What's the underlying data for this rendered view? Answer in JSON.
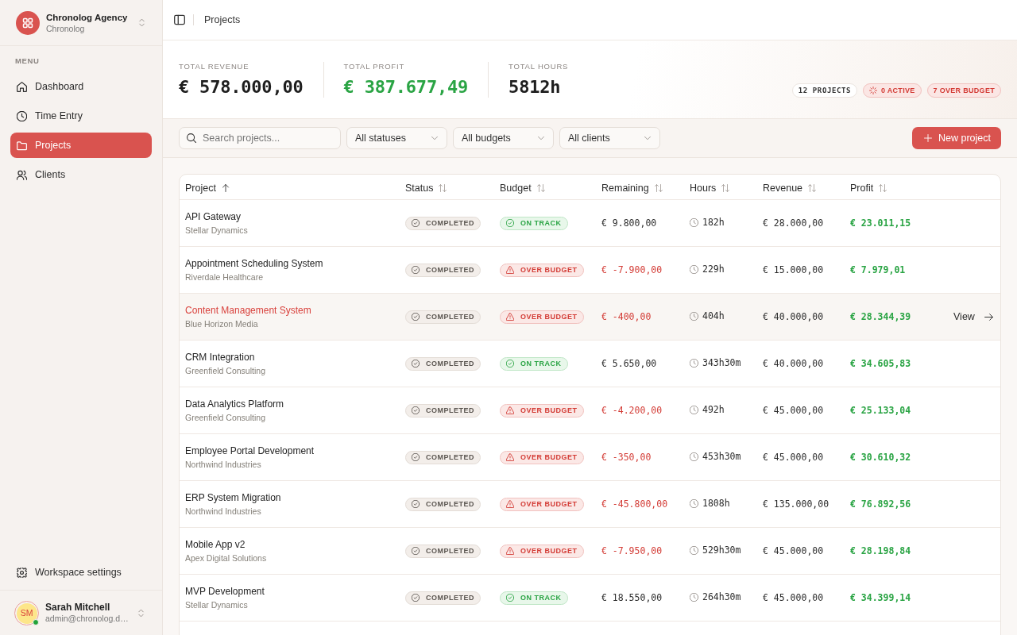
{
  "sidebar": {
    "workspace": {
      "name": "Chronolog Agency",
      "subtitle": "Chronolog"
    },
    "section_label": "MENU",
    "items": [
      {
        "label": "Dashboard",
        "kind": "home",
        "selected": false
      },
      {
        "label": "Time Entry",
        "kind": "clock",
        "selected": false
      },
      {
        "label": "Projects",
        "kind": "folder",
        "selected": true
      },
      {
        "label": "Clients",
        "kind": "users",
        "selected": false
      }
    ],
    "footer_items": [
      {
        "label": "Workspace settings",
        "kind": "gear"
      }
    ],
    "user": {
      "initials": "SM",
      "name": "Sarah Mitchell",
      "email": "admin@chronolog.d…",
      "online": true
    }
  },
  "topbar": {
    "title": "Projects"
  },
  "stats": [
    {
      "label": "TOTAL REVENUE",
      "value": "€ 578.000,00",
      "positive": false
    },
    {
      "label": "TOTAL PROFIT",
      "value": "€ 387.677,49",
      "positive": true
    },
    {
      "label": "TOTAL HOURS",
      "value": "5812h",
      "positive": false
    }
  ],
  "badges": [
    {
      "text": "12 PROJECTS",
      "kind": "count"
    },
    {
      "text": "0 ACTIVE",
      "kind": "active"
    },
    {
      "text": "7 OVER BUDGET",
      "kind": "over_budget"
    }
  ],
  "filters": {
    "search": {
      "placeholder": "Search projects..."
    },
    "dropdowns": [
      "All statuses",
      "All budgets",
      "All clients"
    ],
    "new_button": "New project"
  },
  "table": {
    "columns": [
      {
        "label": "Project",
        "sorted": true
      },
      {
        "label": "Status",
        "sorted": false
      },
      {
        "label": "Budget",
        "sorted": false
      },
      {
        "label": "Remaining",
        "sorted": false
      },
      {
        "label": "Hours",
        "sorted": false
      },
      {
        "label": "Revenue",
        "sorted": false
      },
      {
        "label": "Profit",
        "sorted": false
      }
    ],
    "row_action": "View",
    "rows": [
      {
        "name": "API Gateway",
        "client": "Stellar Dynamics",
        "status": {
          "label": "COMPLETED",
          "kind": "completed"
        },
        "budget": {
          "label": "ON TRACK",
          "kind": "on_track"
        },
        "remaining": "€ 9.800,00",
        "remaining_negative": false,
        "hours": "182h",
        "revenue": "€ 28.000,00",
        "profit": "€ 23.011,15",
        "hovered": false
      },
      {
        "name": "Appointment Scheduling System",
        "client": "Riverdale Healthcare",
        "status": {
          "label": "COMPLETED",
          "kind": "completed"
        },
        "budget": {
          "label": "OVER BUDGET",
          "kind": "over_budget"
        },
        "remaining": "€ -7.900,00",
        "remaining_negative": true,
        "hours": "229h",
        "revenue": "€ 15.000,00",
        "profit": "€ 7.979,01",
        "hovered": false
      },
      {
        "name": "Content Management System",
        "client": "Blue Horizon Media",
        "status": {
          "label": "COMPLETED",
          "kind": "completed"
        },
        "budget": {
          "label": "OVER BUDGET",
          "kind": "over_budget"
        },
        "remaining": "€ -400,00",
        "remaining_negative": true,
        "hours": "404h",
        "revenue": "€ 40.000,00",
        "profit": "€ 28.344,39",
        "hovered": true
      },
      {
        "name": "CRM Integration",
        "client": "Greenfield Consulting",
        "status": {
          "label": "COMPLETED",
          "kind": "completed"
        },
        "budget": {
          "label": "ON TRACK",
          "kind": "on_track"
        },
        "remaining": "€ 5.650,00",
        "remaining_negative": false,
        "hours": "343h30m",
        "revenue": "€ 40.000,00",
        "profit": "€ 34.605,83",
        "hovered": false
      },
      {
        "name": "Data Analytics Platform",
        "client": "Greenfield Consulting",
        "status": {
          "label": "COMPLETED",
          "kind": "completed"
        },
        "budget": {
          "label": "OVER BUDGET",
          "kind": "over_budget"
        },
        "remaining": "€ -4.200,00",
        "remaining_negative": true,
        "hours": "492h",
        "revenue": "€ 45.000,00",
        "profit": "€ 25.133,04",
        "hovered": false
      },
      {
        "name": "Employee Portal Development",
        "client": "Northwind Industries",
        "status": {
          "label": "COMPLETED",
          "kind": "completed"
        },
        "budget": {
          "label": "OVER BUDGET",
          "kind": "over_budget"
        },
        "remaining": "€ -350,00",
        "remaining_negative": true,
        "hours": "453h30m",
        "revenue": "€ 45.000,00",
        "profit": "€ 30.610,32",
        "hovered": false
      },
      {
        "name": "ERP System Migration",
        "client": "Northwind Industries",
        "status": {
          "label": "COMPLETED",
          "kind": "completed"
        },
        "budget": {
          "label": "OVER BUDGET",
          "kind": "over_budget"
        },
        "remaining": "€ -45.800,00",
        "remaining_negative": true,
        "hours": "1808h",
        "revenue": "€ 135.000,00",
        "profit": "€ 76.892,56",
        "hovered": false
      },
      {
        "name": "Mobile App v2",
        "client": "Apex Digital Solutions",
        "status": {
          "label": "COMPLETED",
          "kind": "completed"
        },
        "budget": {
          "label": "OVER BUDGET",
          "kind": "over_budget"
        },
        "remaining": "€ -7.950,00",
        "remaining_negative": true,
        "hours": "529h30m",
        "revenue": "€ 45.000,00",
        "profit": "€ 28.198,84",
        "hovered": false
      },
      {
        "name": "MVP Development",
        "client": "Stellar Dynamics",
        "status": {
          "label": "COMPLETED",
          "kind": "completed"
        },
        "budget": {
          "label": "ON TRACK",
          "kind": "on_track"
        },
        "remaining": "€ 18.550,00",
        "remaining_negative": false,
        "hours": "264h30m",
        "revenue": "€ 45.000,00",
        "profit": "€ 34.399,14",
        "hovered": false
      }
    ]
  }
}
